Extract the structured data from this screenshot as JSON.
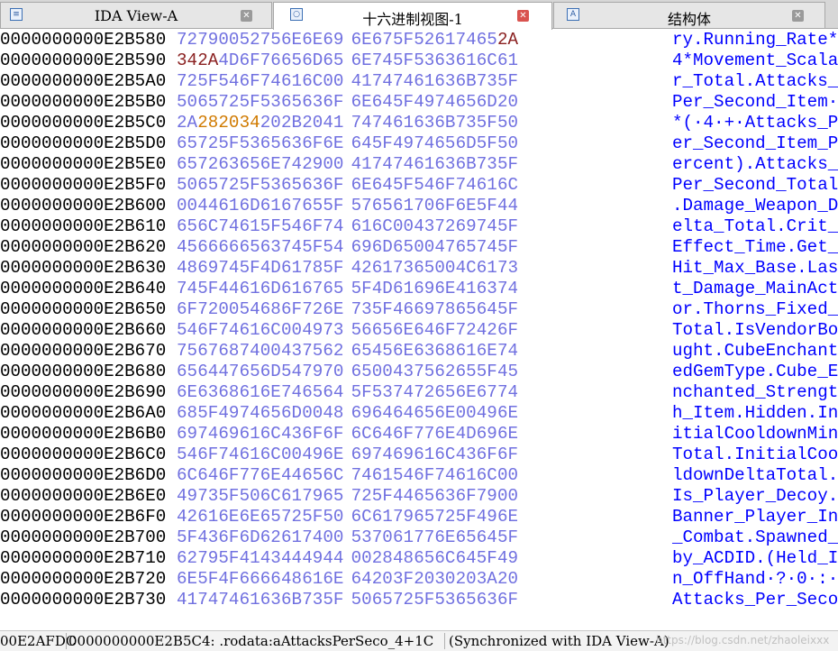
{
  "tabs": [
    {
      "label": "IDA View-A",
      "icon": "ida-view-icon",
      "active": false
    },
    {
      "label": "十六进制视图-1",
      "icon": "hex-view-icon",
      "active": true
    },
    {
      "label": "结构体",
      "icon": "structures-icon",
      "active": false
    }
  ],
  "hex_rows": [
    {
      "addr": "0000000000E2B580",
      "bytes": [
        "72",
        "79",
        "00",
        "52",
        "75",
        "6E",
        "6E",
        "69",
        "6E",
        "67",
        "5F",
        "52",
        "61",
        "74",
        "65",
        "2A"
      ],
      "ascii": "ry.Running_Rate*"
    },
    {
      "addr": "0000000000E2B590",
      "bytes": [
        "34",
        "2A",
        "4D",
        "6F",
        "76",
        "65",
        "6D",
        "65",
        "6E",
        "74",
        "5F",
        "53",
        "63",
        "61",
        "6C",
        "61"
      ],
      "ascii": "4*Movement_Scala"
    },
    {
      "addr": "0000000000E2B5A0",
      "bytes": [
        "72",
        "5F",
        "54",
        "6F",
        "74",
        "61",
        "6C",
        "00",
        "41",
        "74",
        "74",
        "61",
        "63",
        "6B",
        "73",
        "5F"
      ],
      "ascii": "r_Total.Attacks_"
    },
    {
      "addr": "0000000000E2B5B0",
      "bytes": [
        "50",
        "65",
        "72",
        "5F",
        "53",
        "65",
        "63",
        "6F",
        "6E",
        "64",
        "5F",
        "49",
        "74",
        "65",
        "6D",
        "20"
      ],
      "ascii": "Per_Second_Item·"
    },
    {
      "addr": "0000000000E2B5C0",
      "bytes": [
        "2A",
        "28",
        "20",
        "34",
        "20",
        "2B",
        "20",
        "41",
        "74",
        "74",
        "61",
        "63",
        "6B",
        "73",
        "5F",
        "50"
      ],
      "ascii": "*(·4·+·Attacks_P"
    },
    {
      "addr": "0000000000E2B5D0",
      "bytes": [
        "65",
        "72",
        "5F",
        "53",
        "65",
        "63",
        "6F",
        "6E",
        "64",
        "5F",
        "49",
        "74",
        "65",
        "6D",
        "5F",
        "50"
      ],
      "ascii": "er_Second_Item_P"
    },
    {
      "addr": "0000000000E2B5E0",
      "bytes": [
        "65",
        "72",
        "63",
        "65",
        "6E",
        "74",
        "29",
        "00",
        "41",
        "74",
        "74",
        "61",
        "63",
        "6B",
        "73",
        "5F"
      ],
      "ascii": "ercent).Attacks_"
    },
    {
      "addr": "0000000000E2B5F0",
      "bytes": [
        "50",
        "65",
        "72",
        "5F",
        "53",
        "65",
        "63",
        "6F",
        "6E",
        "64",
        "5F",
        "54",
        "6F",
        "74",
        "61",
        "6C"
      ],
      "ascii": "Per_Second_Total"
    },
    {
      "addr": "0000000000E2B600",
      "bytes": [
        "00",
        "44",
        "61",
        "6D",
        "61",
        "67",
        "65",
        "5F",
        "57",
        "65",
        "61",
        "70",
        "6F",
        "6E",
        "5F",
        "44"
      ],
      "ascii": ".Damage_Weapon_D"
    },
    {
      "addr": "0000000000E2B610",
      "bytes": [
        "65",
        "6C",
        "74",
        "61",
        "5F",
        "54",
        "6F",
        "74",
        "61",
        "6C",
        "00",
        "43",
        "72",
        "69",
        "74",
        "5F"
      ],
      "ascii": "elta_Total.Crit_"
    },
    {
      "addr": "0000000000E2B620",
      "bytes": [
        "45",
        "66",
        "66",
        "65",
        "63",
        "74",
        "5F",
        "54",
        "69",
        "6D",
        "65",
        "00",
        "47",
        "65",
        "74",
        "5F"
      ],
      "ascii": "Effect_Time.Get_"
    },
    {
      "addr": "0000000000E2B630",
      "bytes": [
        "48",
        "69",
        "74",
        "5F",
        "4D",
        "61",
        "78",
        "5F",
        "42",
        "61",
        "73",
        "65",
        "00",
        "4C",
        "61",
        "73"
      ],
      "ascii": "Hit_Max_Base.Las"
    },
    {
      "addr": "0000000000E2B640",
      "bytes": [
        "74",
        "5F",
        "44",
        "61",
        "6D",
        "61",
        "67",
        "65",
        "5F",
        "4D",
        "61",
        "69",
        "6E",
        "41",
        "63",
        "74"
      ],
      "ascii": "t_Damage_MainAct"
    },
    {
      "addr": "0000000000E2B650",
      "bytes": [
        "6F",
        "72",
        "00",
        "54",
        "68",
        "6F",
        "72",
        "6E",
        "73",
        "5F",
        "46",
        "69",
        "78",
        "65",
        "64",
        "5F"
      ],
      "ascii": "or.Thorns_Fixed_"
    },
    {
      "addr": "0000000000E2B660",
      "bytes": [
        "54",
        "6F",
        "74",
        "61",
        "6C",
        "00",
        "49",
        "73",
        "56",
        "65",
        "6E",
        "64",
        "6F",
        "72",
        "42",
        "6F"
      ],
      "ascii": "Total.IsVendorBo"
    },
    {
      "addr": "0000000000E2B670",
      "bytes": [
        "75",
        "67",
        "68",
        "74",
        "00",
        "43",
        "75",
        "62",
        "65",
        "45",
        "6E",
        "63",
        "68",
        "61",
        "6E",
        "74"
      ],
      "ascii": "ught.CubeEnchant"
    },
    {
      "addr": "0000000000E2B680",
      "bytes": [
        "65",
        "64",
        "47",
        "65",
        "6D",
        "54",
        "79",
        "70",
        "65",
        "00",
        "43",
        "75",
        "62",
        "65",
        "5F",
        "45"
      ],
      "ascii": "edGemType.Cube_E"
    },
    {
      "addr": "0000000000E2B690",
      "bytes": [
        "6E",
        "63",
        "68",
        "61",
        "6E",
        "74",
        "65",
        "64",
        "5F",
        "53",
        "74",
        "72",
        "65",
        "6E",
        "67",
        "74"
      ],
      "ascii": "nchanted_Strengt"
    },
    {
      "addr": "0000000000E2B6A0",
      "bytes": [
        "68",
        "5F",
        "49",
        "74",
        "65",
        "6D",
        "00",
        "48",
        "69",
        "64",
        "64",
        "65",
        "6E",
        "00",
        "49",
        "6E"
      ],
      "ascii": "h_Item.Hidden.In"
    },
    {
      "addr": "0000000000E2B6B0",
      "bytes": [
        "69",
        "74",
        "69",
        "61",
        "6C",
        "43",
        "6F",
        "6F",
        "6C",
        "64",
        "6F",
        "77",
        "6E",
        "4D",
        "69",
        "6E"
      ],
      "ascii": "itialCooldownMin"
    },
    {
      "addr": "0000000000E2B6C0",
      "bytes": [
        "54",
        "6F",
        "74",
        "61",
        "6C",
        "00",
        "49",
        "6E",
        "69",
        "74",
        "69",
        "61",
        "6C",
        "43",
        "6F",
        "6F"
      ],
      "ascii": "Total.InitialCoo"
    },
    {
      "addr": "0000000000E2B6D0",
      "bytes": [
        "6C",
        "64",
        "6F",
        "77",
        "6E",
        "44",
        "65",
        "6C",
        "74",
        "61",
        "54",
        "6F",
        "74",
        "61",
        "6C",
        "00"
      ],
      "ascii": "ldownDeltaTotal."
    },
    {
      "addr": "0000000000E2B6E0",
      "bytes": [
        "49",
        "73",
        "5F",
        "50",
        "6C",
        "61",
        "79",
        "65",
        "72",
        "5F",
        "44",
        "65",
        "63",
        "6F",
        "79",
        "00"
      ],
      "ascii": "Is_Player_Decoy."
    },
    {
      "addr": "0000000000E2B6F0",
      "bytes": [
        "42",
        "61",
        "6E",
        "6E",
        "65",
        "72",
        "5F",
        "50",
        "6C",
        "61",
        "79",
        "65",
        "72",
        "5F",
        "49",
        "6E"
      ],
      "ascii": "Banner_Player_In"
    },
    {
      "addr": "0000000000E2B700",
      "bytes": [
        "5F",
        "43",
        "6F",
        "6D",
        "62",
        "61",
        "74",
        "00",
        "53",
        "70",
        "61",
        "77",
        "6E",
        "65",
        "64",
        "5F"
      ],
      "ascii": "_Combat.Spawned_"
    },
    {
      "addr": "0000000000E2B710",
      "bytes": [
        "62",
        "79",
        "5F",
        "41",
        "43",
        "44",
        "49",
        "44",
        "00",
        "28",
        "48",
        "65",
        "6C",
        "64",
        "5F",
        "49"
      ],
      "ascii": "by_ACDID.(Held_I"
    },
    {
      "addr": "0000000000E2B720",
      "bytes": [
        "6E",
        "5F",
        "4F",
        "66",
        "66",
        "48",
        "61",
        "6E",
        "64",
        "20",
        "3F",
        "20",
        "30",
        "20",
        "3A",
        "20"
      ],
      "ascii": "n_OffHand·?·0·:·"
    },
    {
      "addr": "0000000000E2B730",
      "bytes": [
        "41",
        "74",
        "74",
        "61",
        "63",
        "6B",
        "73",
        "5F",
        "50",
        "65",
        "72",
        "5F",
        "53",
        "65",
        "63",
        "6F"
      ],
      "ascii": "Attacks_Per_Seco"
    }
  ],
  "byte_highlights": {
    "red": [
      {
        "row": 0,
        "col": 15
      },
      {
        "row": 1,
        "col": 0
      },
      {
        "row": 1,
        "col": 1
      }
    ],
    "modified": [
      {
        "row": 4,
        "col": 1
      },
      {
        "row": 4,
        "col": 2
      },
      {
        "row": 4,
        "col": 3
      }
    ]
  },
  "colors": {
    "hex_bytes": "#7070e0",
    "ascii": "#0000ff",
    "modified": "#d07a00",
    "red_bytes": "#8a2020"
  },
  "status": {
    "offset": "00E2AFDC",
    "location": "0000000000E2B5C4: .rodata:aAttacksPerSeco_4+1C",
    "sync": "(Synchronized with IDA View-A)",
    "watermark": "https://blog.csdn.net/zhaoleixxx"
  }
}
